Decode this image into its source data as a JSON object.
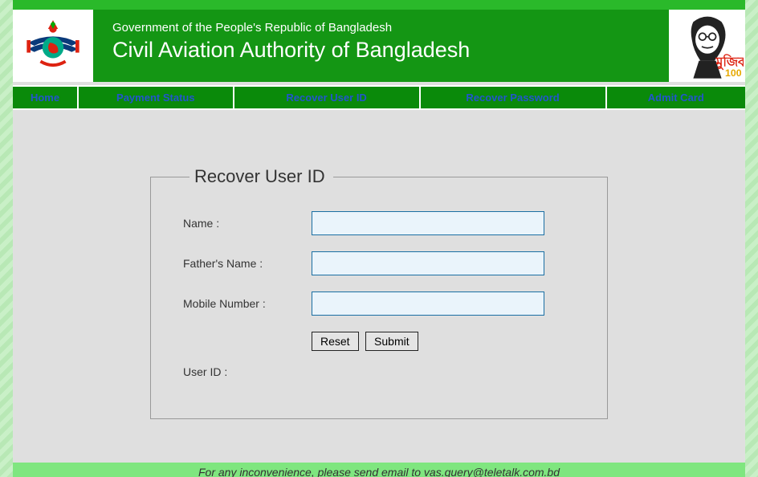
{
  "header": {
    "gov_line": "Government of the People's Republic of Bangladesh",
    "org_line": "Civil Aviation Authority of Bangladesh"
  },
  "nav": {
    "home": "Home",
    "payment_status": "Payment Status",
    "recover_user_id": "Recover User ID",
    "recover_password": "Recover Password",
    "admit_card": "Admit Card"
  },
  "form": {
    "legend": "Recover User ID",
    "name_label": "Name :",
    "father_label": "Father's Name :",
    "mobile_label": "Mobile Number :",
    "name_value": "",
    "father_value": "",
    "mobile_value": "",
    "reset_btn": "Reset",
    "submit_btn": "Submit",
    "userid_label": "User ID :"
  },
  "footer": {
    "text": "For any inconvenience, please send email to vas.query@teletalk.com.bd"
  }
}
